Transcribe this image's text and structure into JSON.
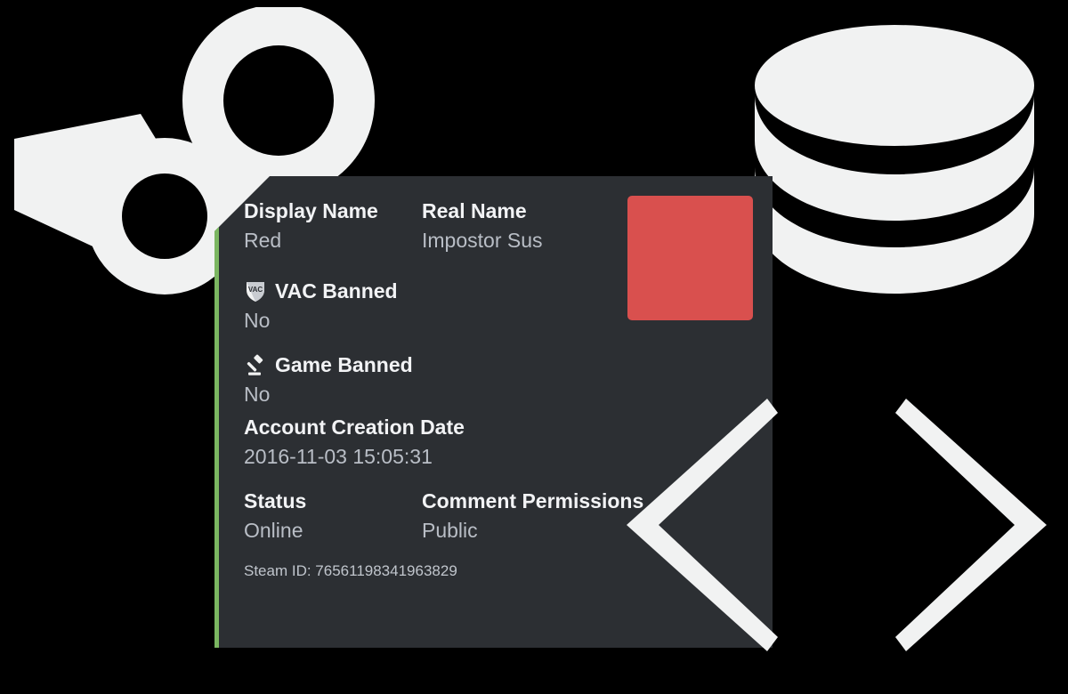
{
  "page": {
    "background_color": "#000000",
    "card_background_color": "#2c2f33",
    "accent_border_color": "#7bb661",
    "avatar_color": "#d9504e",
    "label_color": "#f2f3f5",
    "value_color": "#b9bec6"
  },
  "decorations": [
    {
      "name": "steam-logo-icon",
      "label": "Steam logo"
    },
    {
      "name": "database-icon",
      "label": "Database"
    },
    {
      "name": "code-bracket-left-icon",
      "label": "Less-than bracket"
    },
    {
      "name": "code-bracket-right-icon",
      "label": "Greater-than bracket"
    }
  ],
  "card": {
    "avatar": {
      "name": "profile-avatar",
      "color": "#d9504e"
    },
    "fields": {
      "display_name": {
        "label": "Display Name",
        "value": "Red"
      },
      "real_name": {
        "label": "Real Name",
        "value": "Impostor Sus"
      },
      "vac_banned": {
        "label": "VAC Banned",
        "value": "No",
        "icon": "vac-shield-icon"
      },
      "game_banned": {
        "label": "Game Banned",
        "value": "No",
        "icon": "gavel-icon"
      },
      "account_creation_date": {
        "label": "Account Creation Date",
        "value": "2016-11-03 15:05:31"
      },
      "status": {
        "label": "Status",
        "value": "Online"
      },
      "comment_permissions": {
        "label": "Comment Permissions",
        "value": "Public"
      }
    },
    "steam_id_line": "Steam ID: 76561198341963829"
  }
}
